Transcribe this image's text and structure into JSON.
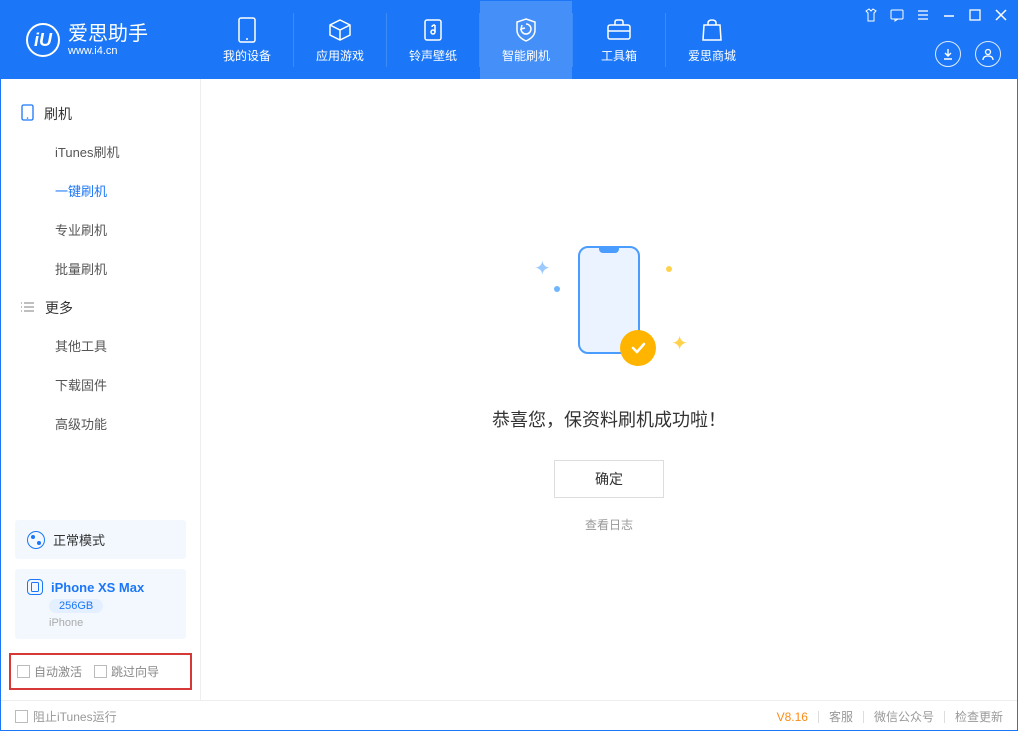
{
  "logo": {
    "mark": "iU",
    "main": "爱思助手",
    "sub": "www.i4.cn"
  },
  "nav": {
    "device": "我的设备",
    "apps": "应用游戏",
    "ring": "铃声壁纸",
    "flash": "智能刷机",
    "tools": "工具箱",
    "store": "爱思商城"
  },
  "sidebar": {
    "group_flash": "刷机",
    "items_flash": {
      "itunes": "iTunes刷机",
      "oneclick": "一键刷机",
      "pro": "专业刷机",
      "batch": "批量刷机"
    },
    "group_more": "更多",
    "items_more": {
      "othertools": "其他工具",
      "firmware": "下载固件",
      "advanced": "高级功能"
    }
  },
  "mode": {
    "label": "正常模式"
  },
  "device": {
    "name": "iPhone XS Max",
    "capacity": "256GB",
    "type": "iPhone"
  },
  "options": {
    "auto_activate": "自动激活",
    "skip_wizard": "跳过向导"
  },
  "result": {
    "message": "恭喜您，保资料刷机成功啦！",
    "ok": "确定",
    "view_log": "查看日志"
  },
  "status": {
    "block_itunes": "阻止iTunes运行",
    "version": "V8.16",
    "service": "客服",
    "wechat": "微信公众号",
    "update": "检查更新"
  }
}
